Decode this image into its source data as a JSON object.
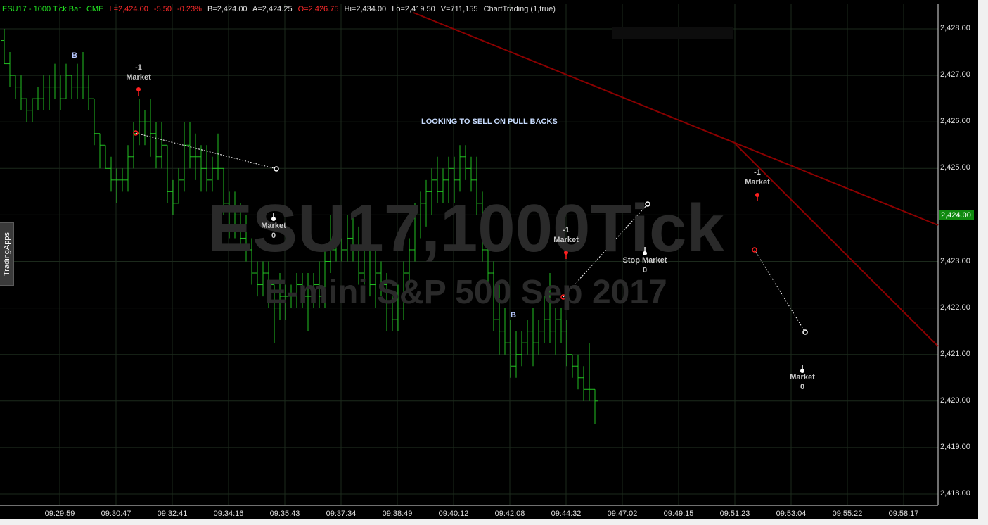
{
  "header": {
    "symbol": "ESU17 - 1000 Tick Bar",
    "exchange": "CME",
    "last": "L=2,424.00",
    "change": "-5.50",
    "change_pct": "-0.23%",
    "bid": "B=2,424.00",
    "ask": "A=2,424.25",
    "open": "O=2,426.75",
    "high": "Hi=2,434.00",
    "low": "Lo=2,419.50",
    "volume": "V=711,155",
    "indicator": "ChartTrading (1,true)"
  },
  "side_tab": {
    "label": "TradingApps"
  },
  "watermark": {
    "symbol": "ESU17,1000Tick",
    "name": "E-mini S&P 500 Sep 2017"
  },
  "note": "LOOKING TO SELL ON PULL BACKS",
  "current_price": "2,424.00",
  "colors": {
    "bar": "#22c022",
    "trendline": "#8b0000",
    "sell": "#ff2020",
    "buy": "#ffffff",
    "current_price_bg": "#0f8a0f"
  },
  "price_axis": [
    "2,428.00",
    "2,427.00",
    "2,426.00",
    "2,425.00",
    "2,424.00",
    "2,423.00",
    "2,422.00",
    "2,421.00",
    "2,420.00",
    "2,419.00",
    "2,418.00"
  ],
  "time_axis": [
    "09:29:59",
    "09:30:47",
    "09:32:41",
    "09:34:16",
    "09:35:43",
    "09:37:34",
    "09:38:49",
    "09:40:12",
    "09:42:08",
    "09:44:32",
    "09:47:02",
    "09:49:15",
    "09:51:23",
    "09:53:04",
    "09:55:22",
    "09:58:17"
  ],
  "annotations": {
    "b1": "B",
    "b2": "B",
    "sell1_qty": "-1",
    "sell1_type": "Market",
    "buy1_type": "Market",
    "buy1_qty": "0",
    "sell2_qty": "-1",
    "sell2_type": "Market",
    "buy2_type": "Stop Market",
    "buy2_qty": "0",
    "sell3_qty": "-1",
    "sell3_type": "Market",
    "buy3_type": "Market",
    "buy3_qty": "0"
  },
  "chart_data": {
    "type": "ohlc",
    "bar_type": "1000 Tick",
    "ylim": [
      2417.75,
      2428.5
    ],
    "bars": [
      [
        2427.75,
        2428.0,
        2427.25,
        2427.25
      ],
      [
        2427.25,
        2427.5,
        2426.75,
        2427.0
      ],
      [
        2427.0,
        2427.0,
        2426.5,
        2426.75
      ],
      [
        2426.75,
        2427.0,
        2426.25,
        2426.5
      ],
      [
        2426.5,
        2426.5,
        2426.0,
        2426.25
      ],
      [
        2426.25,
        2426.5,
        2426.0,
        2426.5
      ],
      [
        2426.5,
        2426.75,
        2426.25,
        2426.5
      ],
      [
        2426.5,
        2427.0,
        2426.25,
        2426.75
      ],
      [
        2426.75,
        2427.0,
        2426.25,
        2426.75
      ],
      [
        2426.75,
        2427.25,
        2426.5,
        2426.75
      ],
      [
        2426.75,
        2427.0,
        2426.25,
        2426.5
      ],
      [
        2426.5,
        2427.25,
        2426.5,
        2427.0
      ],
      [
        2427.0,
        2427.0,
        2426.5,
        2426.75
      ],
      [
        2426.75,
        2427.25,
        2426.5,
        2426.75
      ],
      [
        2426.75,
        2427.5,
        2426.5,
        2426.75
      ],
      [
        2426.75,
        2427.0,
        2426.25,
        2426.5
      ],
      [
        2426.5,
        2426.5,
        2425.5,
        2425.75
      ],
      [
        2425.75,
        2425.75,
        2425.0,
        2425.5
      ],
      [
        2425.5,
        2425.5,
        2425.0,
        2425.0
      ],
      [
        2425.0,
        2425.25,
        2424.5,
        2424.75
      ],
      [
        2424.75,
        2425.0,
        2424.25,
        2424.75
      ],
      [
        2424.75,
        2425.0,
        2424.5,
        2424.75
      ],
      [
        2424.75,
        2425.5,
        2424.5,
        2425.25
      ],
      [
        2425.25,
        2426.0,
        2425.0,
        2425.75
      ],
      [
        2425.75,
        2426.5,
        2425.5,
        2426.0
      ],
      [
        2426.0,
        2426.25,
        2425.5,
        2426.0
      ],
      [
        2426.0,
        2426.5,
        2425.25,
        2425.75
      ],
      [
        2425.75,
        2426.0,
        2425.0,
        2425.25
      ],
      [
        2425.25,
        2426.0,
        2425.0,
        2425.5
      ],
      [
        2425.5,
        2425.5,
        2424.25,
        2424.5
      ],
      [
        2424.5,
        2424.75,
        2424.0,
        2424.25
      ],
      [
        2424.25,
        2425.0,
        2424.25,
        2424.75
      ],
      [
        2424.75,
        2426.0,
        2424.5,
        2425.5
      ],
      [
        2425.5,
        2426.0,
        2425.0,
        2425.25
      ],
      [
        2425.25,
        2425.75,
        2424.75,
        2425.25
      ],
      [
        2425.25,
        2425.5,
        2424.5,
        2425.0
      ],
      [
        2425.0,
        2425.5,
        2424.5,
        2424.75
      ],
      [
        2424.75,
        2425.25,
        2424.5,
        2425.0
      ],
      [
        2425.0,
        2425.75,
        2424.75,
        2425.0
      ],
      [
        2425.0,
        2425.0,
        2424.0,
        2424.25
      ],
      [
        2424.25,
        2424.5,
        2423.5,
        2423.75
      ],
      [
        2423.75,
        2424.5,
        2423.5,
        2424.0
      ],
      [
        2424.0,
        2424.25,
        2423.25,
        2423.5
      ],
      [
        2423.5,
        2424.0,
        2423.0,
        2423.25
      ],
      [
        2423.25,
        2423.5,
        2422.5,
        2422.75
      ],
      [
        2422.75,
        2423.0,
        2422.25,
        2422.5
      ],
      [
        2422.5,
        2423.0,
        2422.25,
        2422.75
      ],
      [
        2422.75,
        2423.0,
        2422.0,
        2422.5
      ],
      [
        2422.5,
        2422.5,
        2421.25,
        2422.0
      ],
      [
        2422.0,
        2422.75,
        2421.75,
        2422.25
      ],
      [
        2422.25,
        2422.5,
        2421.75,
        2422.25
      ],
      [
        2422.25,
        2422.5,
        2422.0,
        2422.25
      ],
      [
        2422.25,
        2422.75,
        2422.0,
        2422.5
      ],
      [
        2422.5,
        2422.75,
        2422.0,
        2422.25
      ],
      [
        2422.25,
        2422.75,
        2421.5,
        2422.25
      ],
      [
        2422.25,
        2422.75,
        2422.0,
        2422.5
      ],
      [
        2422.5,
        2423.0,
        2422.0,
        2422.25
      ],
      [
        2422.25,
        2423.25,
        2422.0,
        2423.0
      ],
      [
        2423.0,
        2424.0,
        2422.75,
        2423.25
      ],
      [
        2423.25,
        2423.75,
        2423.0,
        2423.5
      ],
      [
        2423.5,
        2424.0,
        2423.0,
        2423.25
      ],
      [
        2423.25,
        2424.0,
        2423.0,
        2423.5
      ],
      [
        2423.5,
        2424.0,
        2423.0,
        2423.25
      ],
      [
        2423.25,
        2423.75,
        2422.5,
        2422.75
      ],
      [
        2422.75,
        2423.5,
        2422.5,
        2423.25
      ],
      [
        2423.25,
        2423.5,
        2422.25,
        2422.5
      ],
      [
        2422.5,
        2423.25,
        2422.0,
        2422.75
      ],
      [
        2422.75,
        2423.0,
        2422.25,
        2422.5
      ],
      [
        2422.5,
        2422.75,
        2421.5,
        2422.0
      ],
      [
        2422.0,
        2422.25,
        2421.5,
        2421.75
      ],
      [
        2421.75,
        2422.5,
        2421.5,
        2422.0
      ],
      [
        2422.0,
        2423.0,
        2421.75,
        2422.75
      ],
      [
        2422.75,
        2423.5,
        2422.5,
        2423.25
      ],
      [
        2423.25,
        2424.25,
        2423.0,
        2424.0
      ],
      [
        2424.0,
        2424.5,
        2423.5,
        2424.25
      ],
      [
        2424.25,
        2424.75,
        2423.75,
        2424.5
      ],
      [
        2424.5,
        2425.0,
        2424.0,
        2424.75
      ],
      [
        2424.75,
        2425.25,
        2424.25,
        2424.5
      ],
      [
        2424.5,
        2425.0,
        2424.25,
        2424.75
      ],
      [
        2424.75,
        2425.25,
        2424.25,
        2425.0
      ],
      [
        2425.0,
        2425.25,
        2424.25,
        2424.75
      ],
      [
        2424.75,
        2425.5,
        2424.5,
        2425.25
      ],
      [
        2425.25,
        2425.5,
        2424.75,
        2425.0
      ],
      [
        2425.0,
        2425.25,
        2424.5,
        2424.75
      ],
      [
        2424.75,
        2425.25,
        2424.0,
        2424.25
      ],
      [
        2424.25,
        2424.5,
        2423.0,
        2423.25
      ],
      [
        2423.25,
        2423.5,
        2422.5,
        2422.75
      ],
      [
        2422.75,
        2423.0,
        2421.5,
        2421.75
      ],
      [
        2421.75,
        2422.5,
        2421.0,
        2421.5
      ],
      [
        2421.5,
        2422.0,
        2421.0,
        2421.25
      ],
      [
        2421.25,
        2421.75,
        2420.5,
        2420.75
      ],
      [
        2420.75,
        2421.5,
        2420.5,
        2421.0
      ],
      [
        2421.0,
        2421.5,
        2420.75,
        2421.25
      ],
      [
        2421.25,
        2421.75,
        2421.0,
        2421.5
      ],
      [
        2421.5,
        2422.0,
        2420.75,
        2421.25
      ],
      [
        2421.25,
        2421.75,
        2421.0,
        2421.5
      ],
      [
        2421.5,
        2422.25,
        2421.25,
        2421.75
      ],
      [
        2421.75,
        2422.75,
        2421.25,
        2421.5
      ],
      [
        2421.5,
        2422.0,
        2421.0,
        2421.75
      ],
      [
        2421.75,
        2422.0,
        2421.25,
        2421.5
      ],
      [
        2421.5,
        2421.75,
        2420.75,
        2421.0
      ],
      [
        2421.0,
        2421.0,
        2420.5,
        2420.75
      ],
      [
        2420.75,
        2421.0,
        2420.25,
        2420.5
      ],
      [
        2420.5,
        2420.75,
        2420.0,
        2420.25
      ],
      [
        2420.25,
        2421.25,
        2420.0,
        2420.25
      ],
      [
        2420.25,
        2420.25,
        2419.5,
        2420.0
      ]
    ]
  }
}
